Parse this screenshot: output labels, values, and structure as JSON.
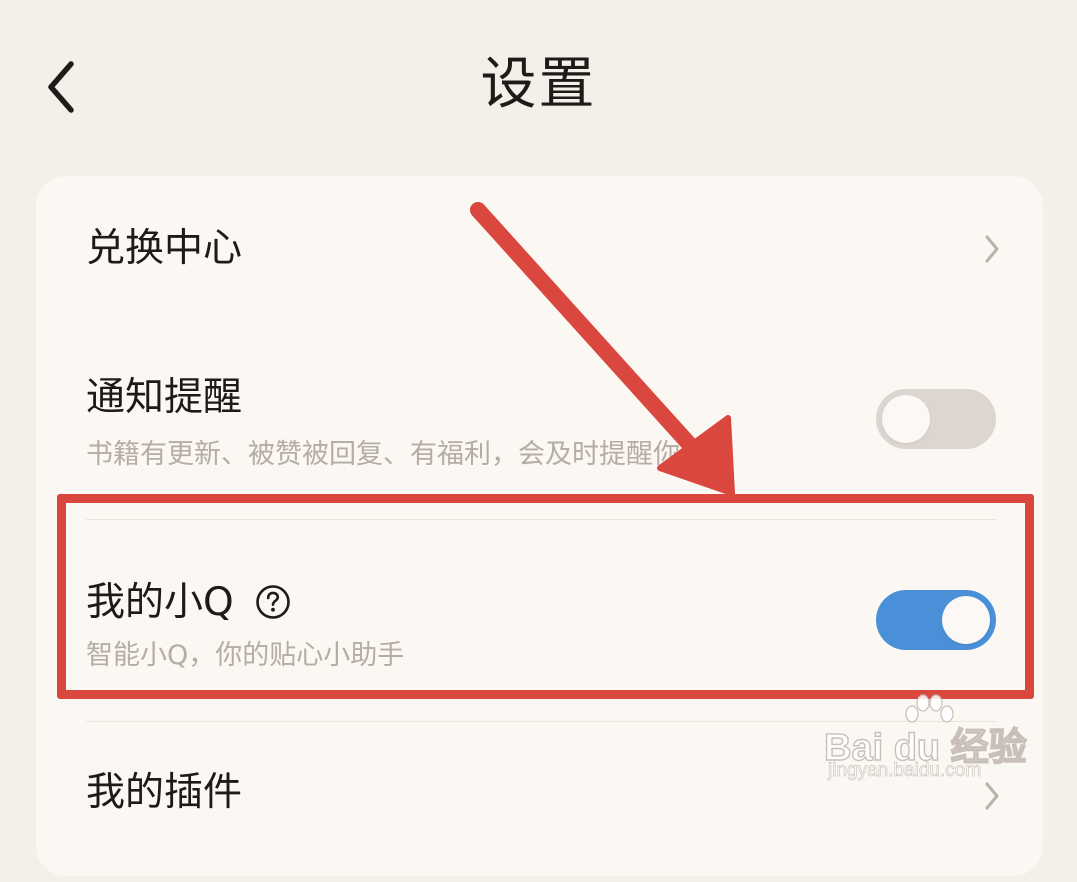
{
  "header": {
    "title": "设置",
    "back_icon": "chevron-left-icon"
  },
  "settings": {
    "items": [
      {
        "label": "兑换中心",
        "control": "chevron",
        "icon": "chevron-right-icon"
      },
      {
        "label": "通知提醒",
        "subtitle": "书籍有更新、被赞被回复、有福利，会及时提醒你",
        "control": "toggle",
        "enabled": false
      },
      {
        "label": "我的小Q",
        "subtitle": "智能小Q，你的贴心小助手",
        "control": "toggle",
        "enabled": true,
        "help_icon": "question-circle-icon"
      },
      {
        "label": "我的插件",
        "control": "chevron",
        "icon": "chevron-right-icon"
      }
    ]
  },
  "annotation": {
    "color": "#d9473f",
    "arrow_icon": "red-arrow-icon",
    "highlight": "red-highlight-box"
  },
  "colors": {
    "background": "#f4efe9",
    "card": "#fbf7f3",
    "toggle_on": "#4a90d8",
    "toggle_off": "#ddd5cf",
    "subtitle": "#b6aca4"
  },
  "watermark": {
    "main": "Bai du 经验",
    "sub": "jingyan.baidu.com"
  }
}
